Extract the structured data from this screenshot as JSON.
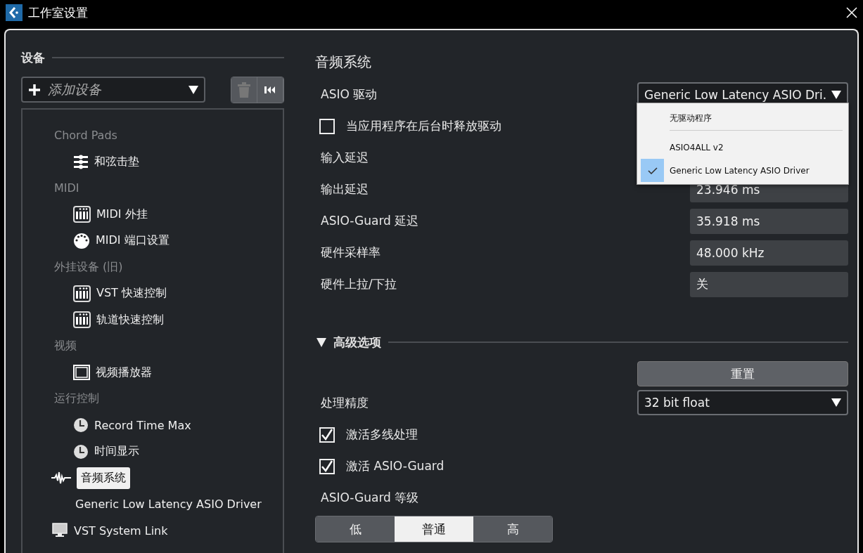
{
  "window": {
    "title": "工作室设置"
  },
  "sidebar": {
    "heading": "设备",
    "add_device": {
      "label": "添加设备"
    },
    "tree": [
      {
        "label": "Chord Pads",
        "kind": "category",
        "children": [
          {
            "label": "和弦击垫",
            "kind": "device",
            "selected": false
          }
        ]
      },
      {
        "label": "MIDI",
        "kind": "category",
        "children": [
          {
            "label": "MIDI 外挂",
            "kind": "device",
            "selected": false
          },
          {
            "label": "MIDI 端口设置",
            "kind": "device",
            "selected": false
          }
        ]
      },
      {
        "label": "外挂设备 (旧)",
        "kind": "category",
        "children": [
          {
            "label": "VST 快速控制",
            "kind": "device",
            "selected": false
          },
          {
            "label": "轨道快速控制",
            "kind": "device",
            "selected": false
          }
        ]
      },
      {
        "label": "视频",
        "kind": "category",
        "children": [
          {
            "label": "视频播放器",
            "kind": "device",
            "selected": false
          }
        ]
      },
      {
        "label": "运行控制",
        "kind": "category",
        "children": [
          {
            "label": "Record Time Max",
            "kind": "device",
            "selected": false
          },
          {
            "label": "时间显示",
            "kind": "device",
            "selected": false
          }
        ]
      },
      {
        "label": "音频系统",
        "kind": "device",
        "selected": true,
        "children": [
          {
            "label": "Generic Low Latency ASIO Driver",
            "kind": "driver",
            "selected": false
          }
        ]
      },
      {
        "label": "VST System Link",
        "kind": "device",
        "selected": false
      }
    ]
  },
  "audio_system": {
    "title": "音频系统",
    "driver": {
      "label": "ASIO 驱动",
      "value": "Generic Low Latency ASIO Dri.",
      "menu": [
        {
          "label": "无驱动程序",
          "selected": false,
          "separator_after": true
        },
        {
          "label": "ASIO4ALL v2",
          "selected": false,
          "separator_after": false
        },
        {
          "label": "Generic Low Latency ASIO Driver",
          "selected": true,
          "separator_after": false
        }
      ]
    },
    "release_driver": {
      "label": "当应用程序在后台时释放驱动",
      "checked": false
    },
    "readouts": [
      {
        "label": "输入延迟"
      },
      {
        "label": "输出延迟",
        "value": "23.946 ms"
      },
      {
        "label": "ASIO-Guard 延迟",
        "value": "35.918 ms"
      },
      {
        "label": "硬件采样率",
        "value": "48.000 kHz"
      },
      {
        "label": "硬件上拉/下拉",
        "value": "关"
      }
    ],
    "advanced": {
      "title": "高级选项",
      "expanded": true,
      "reset_button": "重置",
      "precision": {
        "label": "处理精度",
        "value": "32 bit float"
      },
      "options": [
        {
          "label": "激活多线处理",
          "checked": true
        },
        {
          "label": "激活 ASIO-Guard",
          "checked": true
        }
      ],
      "guard_level": {
        "label": "ASIO-Guard 等级",
        "options": [
          {
            "label": "低",
            "selected": false
          },
          {
            "label": "普通",
            "selected": true
          },
          {
            "label": "高",
            "selected": false
          }
        ]
      }
    }
  }
}
